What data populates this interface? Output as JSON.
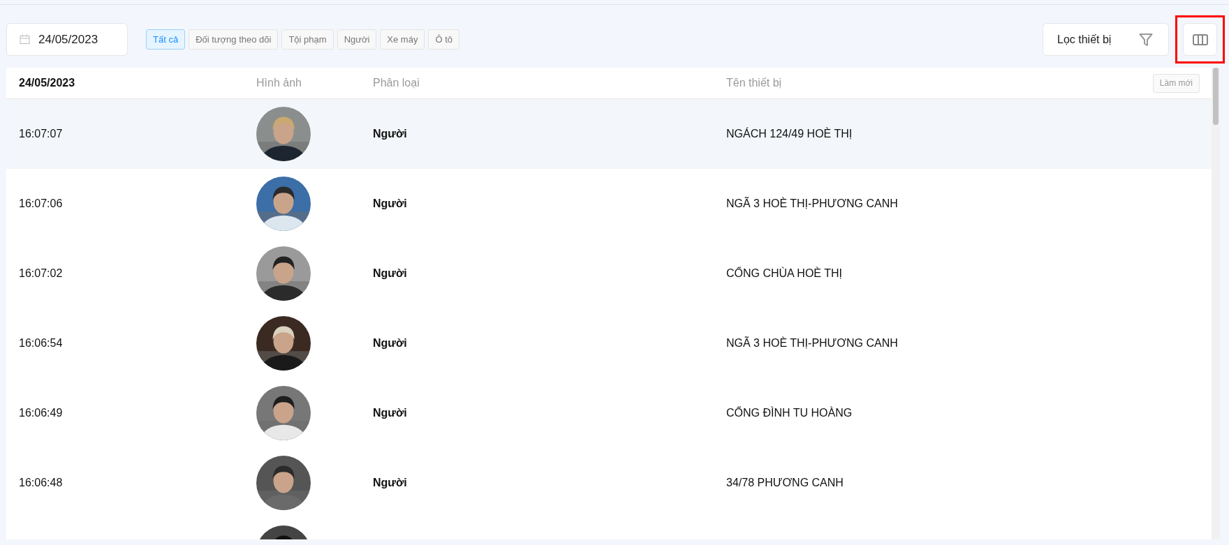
{
  "date_picker": {
    "value": "24/05/2023"
  },
  "filter_tags": [
    {
      "label": "Tất cả",
      "selected": true
    },
    {
      "label": "Đối tượng theo dõi",
      "selected": false
    },
    {
      "label": "Tội phạm",
      "selected": false
    },
    {
      "label": "Người",
      "selected": false
    },
    {
      "label": "Xe máy",
      "selected": false
    },
    {
      "label": "Ô tô",
      "selected": false
    }
  ],
  "device_filter": {
    "label": "Lọc thiết bị"
  },
  "columns_button": {
    "highlighted": true
  },
  "table": {
    "columns": [
      "24/05/2023",
      "Hình ảnh",
      "Phân loại",
      "Tên thiết bị"
    ],
    "refresh_button": "Làm mới",
    "rows": [
      {
        "kind": "entry",
        "selected": true,
        "time": "16:07:07",
        "category": "Người",
        "device": "NGÁCH 124/49 HOÈ THỊ"
      },
      {
        "kind": "entry",
        "selected": false,
        "time": "16:07:06",
        "category": "Người",
        "device": "NGÃ 3 HOÈ THỊ-PHƯƠNG CANH"
      },
      {
        "kind": "entry",
        "selected": false,
        "time": "16:07:02",
        "category": "Người",
        "device": "CỔNG CHÙA HOÈ THỊ"
      },
      {
        "kind": "entry",
        "selected": false,
        "time": "16:06:54",
        "category": "Người",
        "device": "NGÃ 3 HOÈ THỊ-PHƯƠNG CANH"
      },
      {
        "kind": "entry",
        "selected": false,
        "time": "16:06:49",
        "category": "Người",
        "device": "CỔNG ĐÌNH TU HOÀNG"
      },
      {
        "kind": "entry",
        "selected": false,
        "time": "16:06:48",
        "category": "Người",
        "device": "34/78 PHƯƠNG CANH"
      },
      {
        "kind": "picture",
        "selected": false
      }
    ]
  }
}
